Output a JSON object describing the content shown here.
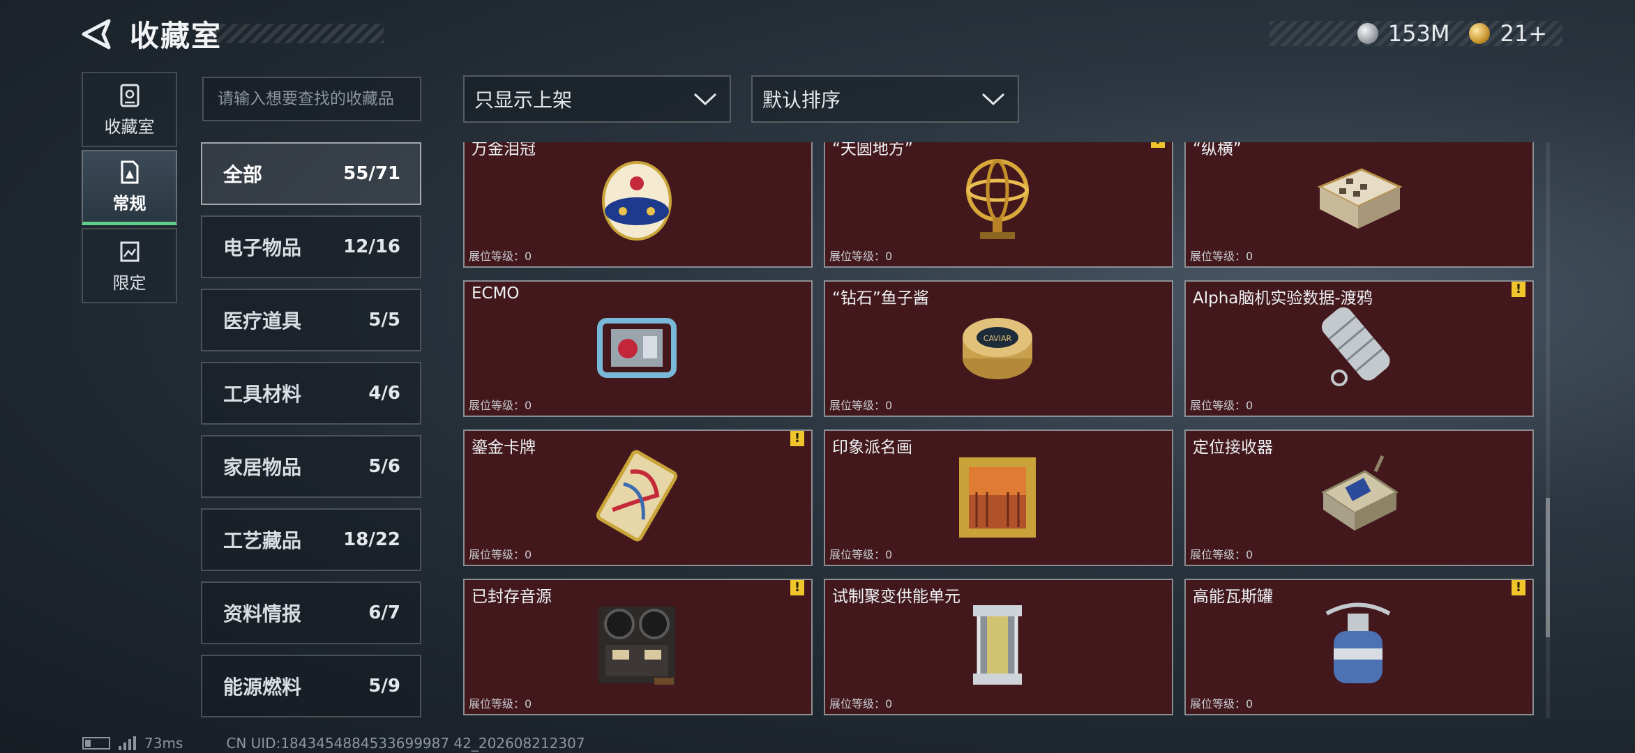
{
  "header": {
    "title": "收藏室"
  },
  "currency": [
    {
      "icon": "silver-coin-icon",
      "value": "153M"
    },
    {
      "icon": "gold-medal-icon",
      "value": "21+"
    }
  ],
  "nav": [
    {
      "label": "收藏室",
      "icon": "collection-room-icon",
      "active": false
    },
    {
      "label": "常规",
      "icon": "regular-icon",
      "active": true
    },
    {
      "label": "限定",
      "icon": "limited-icon",
      "active": false
    }
  ],
  "search": {
    "placeholder": "请输入想要查找的收藏品"
  },
  "filters": {
    "show": "只显示上架",
    "sort": "默认排序"
  },
  "categories": [
    {
      "name": "全部",
      "count": "55/71",
      "active": true
    },
    {
      "name": "电子物品",
      "count": "12/16"
    },
    {
      "name": "医疗道具",
      "count": "5/5"
    },
    {
      "name": "工具材料",
      "count": "4/6"
    },
    {
      "name": "家居物品",
      "count": "5/6"
    },
    {
      "name": "工艺藏品",
      "count": "18/22"
    },
    {
      "name": "资料情报",
      "count": "6/7"
    },
    {
      "name": "能源燃料",
      "count": "5/9"
    }
  ],
  "items": [
    {
      "name": "万金泪冠",
      "level": "展位等级：0",
      "warn": false,
      "art": "jeweled-egg"
    },
    {
      "name": "“天圆地方”",
      "level": "展位等级：0",
      "warn": true,
      "art": "armillary-sphere"
    },
    {
      "name": "“纵横”",
      "level": "展位等级：0",
      "warn": false,
      "art": "chess-box"
    },
    {
      "name": "ECMO",
      "level": "展位等级：0",
      "warn": false,
      "art": "ecmo-machine"
    },
    {
      "name": "“钻石”鱼子酱",
      "level": "展位等级：0",
      "warn": false,
      "art": "caviar-tin"
    },
    {
      "name": "Alpha脑机实验数据-渡鸦",
      "level": "展位等级：0",
      "warn": true,
      "art": "data-cylinder"
    },
    {
      "name": "鎏金卡牌",
      "level": "展位等级：0",
      "warn": true,
      "art": "gold-card"
    },
    {
      "name": "印象派名画",
      "level": "展位等级：0",
      "warn": false,
      "art": "framed-painting"
    },
    {
      "name": "定位接收器",
      "level": "展位等级：0",
      "warn": false,
      "art": "gps-receiver"
    },
    {
      "name": "已封存音源",
      "level": "展位等级：0",
      "warn": true,
      "art": "tape-recorder"
    },
    {
      "name": "试制聚变供能单元",
      "level": "展位等级：0",
      "warn": false,
      "art": "fusion-cell"
    },
    {
      "name": "高能瓦斯罐",
      "level": "展位等级：0",
      "warn": true,
      "art": "gas-canister"
    }
  ],
  "status": {
    "ping": "73ms",
    "uid": "CN UID:1843454884533699987 42_202608212307"
  }
}
